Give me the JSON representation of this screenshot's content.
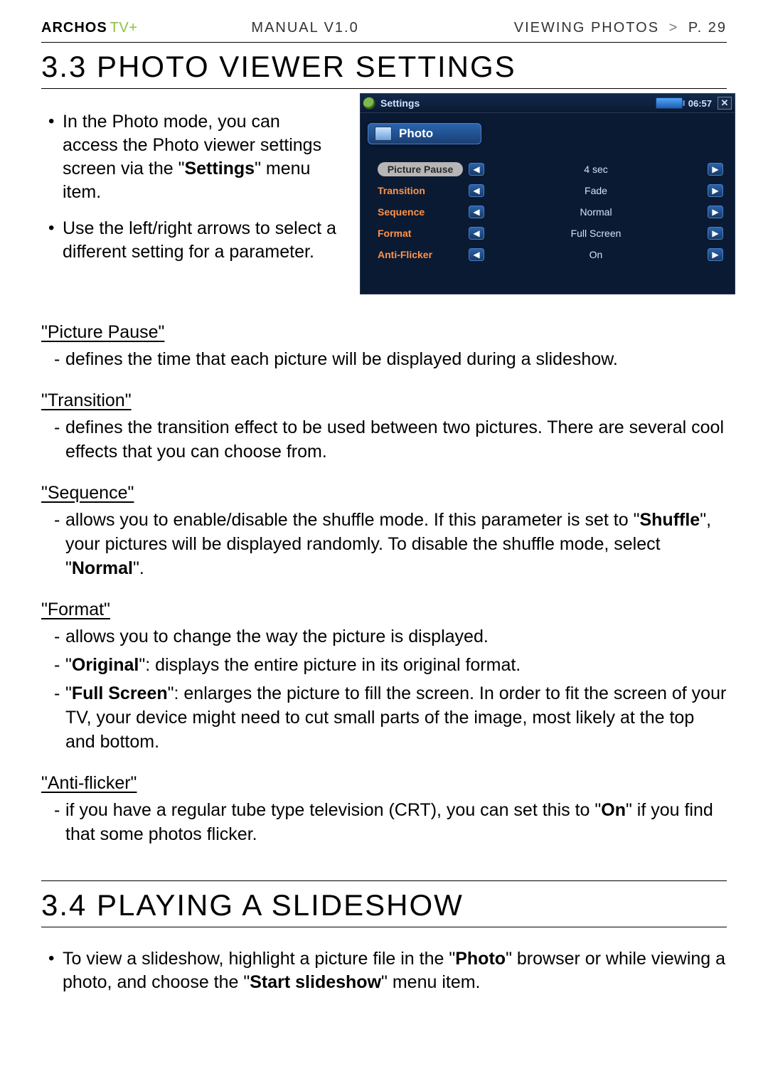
{
  "header": {
    "brand": "ARCHOS",
    "tv": "TV+",
    "manual": "MANUAL V1.0",
    "crumb": "VIEWING PHOTOS",
    "pg": "P. 29"
  },
  "sec33_title": "3.3  PHOTO VIEWER SETTINGS",
  "intro": {
    "b1_a": "In the Photo mode, you can access the Photo viewer settings screen via the \"",
    "b1_bold": "Settings",
    "b1_b": "\" menu item.",
    "b2": "Use the left/right arrows to select a different setting for a parameter."
  },
  "shot": {
    "title": "Settings",
    "clock": "06:57",
    "tab": "Photo",
    "rows": [
      {
        "label": "Picture Pause",
        "value": "4 sec",
        "selected": true
      },
      {
        "label": "Transition",
        "value": "Fade"
      },
      {
        "label": "Sequence",
        "value": "Normal"
      },
      {
        "label": "Format",
        "value": "Full Screen"
      },
      {
        "label": "Anti-Flicker",
        "value": "On"
      }
    ]
  },
  "defs": {
    "picture_pause": {
      "term": "\"Picture Pause\"",
      "d1": "defines the time that each picture will be displayed during a slideshow."
    },
    "transition": {
      "term": "\"Transition\"",
      "d1": "defines the transition effect to be used between two pictures. There are several cool effects that you can choose from."
    },
    "sequence": {
      "term": "\"Sequence\"",
      "d1_a": "allows you to enable/disable the shuffle mode. If this parameter is set to \"",
      "d1_b": "Shuffle",
      "d1_c": "\", your pictures will be displayed randomly. To disable the shuffle mode, select \"",
      "d1_d": "Normal",
      "d1_e": "\"."
    },
    "format": {
      "term": "\"Format\"",
      "d1": "allows you to change the way the picture is displayed.",
      "d2_a": "\"",
      "d2_b": "Original",
      "d2_c": "\": displays the entire picture in its original format.",
      "d3_a": "\"",
      "d3_b": "Full Screen",
      "d3_c": "\": enlarges the picture to fill the screen. In order to fit the screen of your TV, your device might need to cut small parts of the image, most likely at the top and bottom."
    },
    "antiflicker": {
      "term": "\"Anti-flicker\"",
      "d1_a": "if you have a regular tube type television (CRT), you can set this to \"",
      "d1_b": "On",
      "d1_c": "\" if you find that some photos flicker."
    }
  },
  "sec34_title": "3.4  PLAYING A SLIDESHOW",
  "slideshow": {
    "b1_a": "To view a slideshow, highlight a picture file in the \"",
    "b1_b": "Photo",
    "b1_c": "\" browser or while viewing a photo, and choose the \"",
    "b1_d": "Start slideshow",
    "b1_e": "\" menu item."
  }
}
